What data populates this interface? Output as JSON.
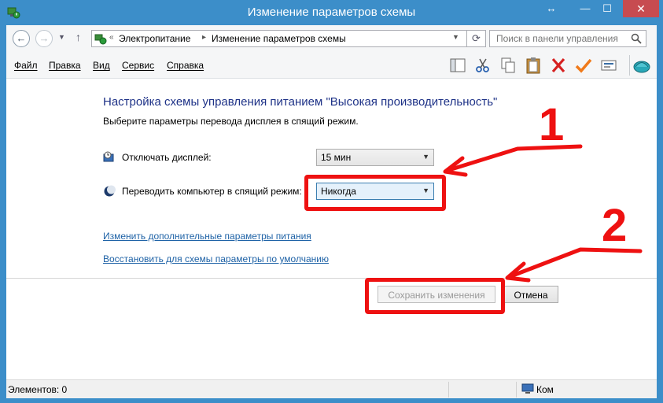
{
  "window": {
    "title": "Изменение параметров схемы",
    "controls": {
      "restore_tiny": "↔",
      "minimize": "—",
      "maximize": "☐",
      "close": "✕"
    }
  },
  "address": {
    "history_glyph": "«",
    "segments": [
      "Электропитание",
      "Изменение параметров схемы"
    ],
    "separator": "▸",
    "search_placeholder": "Поиск в панели управления"
  },
  "menu": {
    "items": [
      "Файл",
      "Правка",
      "Вид",
      "Сервис",
      "Справка"
    ]
  },
  "toolbar": {
    "icons": [
      "panel-icon",
      "scissors-icon",
      "copy-icon",
      "clipboard-icon",
      "delete-icon",
      "checkmark-icon",
      "properties-icon",
      "shell-icon"
    ]
  },
  "content": {
    "heading": "Настройка схемы управления питанием \"Высокая производительность\"",
    "subheading": "Выберите параметры перевода дисплея в спящий режим.",
    "rows": [
      {
        "label": "Отключать дисплей:",
        "value": "15 мин",
        "icon": "monitor-clock-icon"
      },
      {
        "label": "Переводить компьютер в спящий режим:",
        "value": "Никогда",
        "icon": "moon-icon"
      }
    ],
    "links": [
      "Изменить дополнительные параметры питания",
      "Восстановить для схемы параметры по умолчанию"
    ],
    "buttons": {
      "save": "Сохранить изменения",
      "cancel": "Отмена"
    }
  },
  "annotations": {
    "marker_1": "1",
    "marker_2": "2",
    "color": "#ee1111"
  },
  "status": {
    "items_count": "Элементов: 0",
    "computer": "Ком"
  }
}
